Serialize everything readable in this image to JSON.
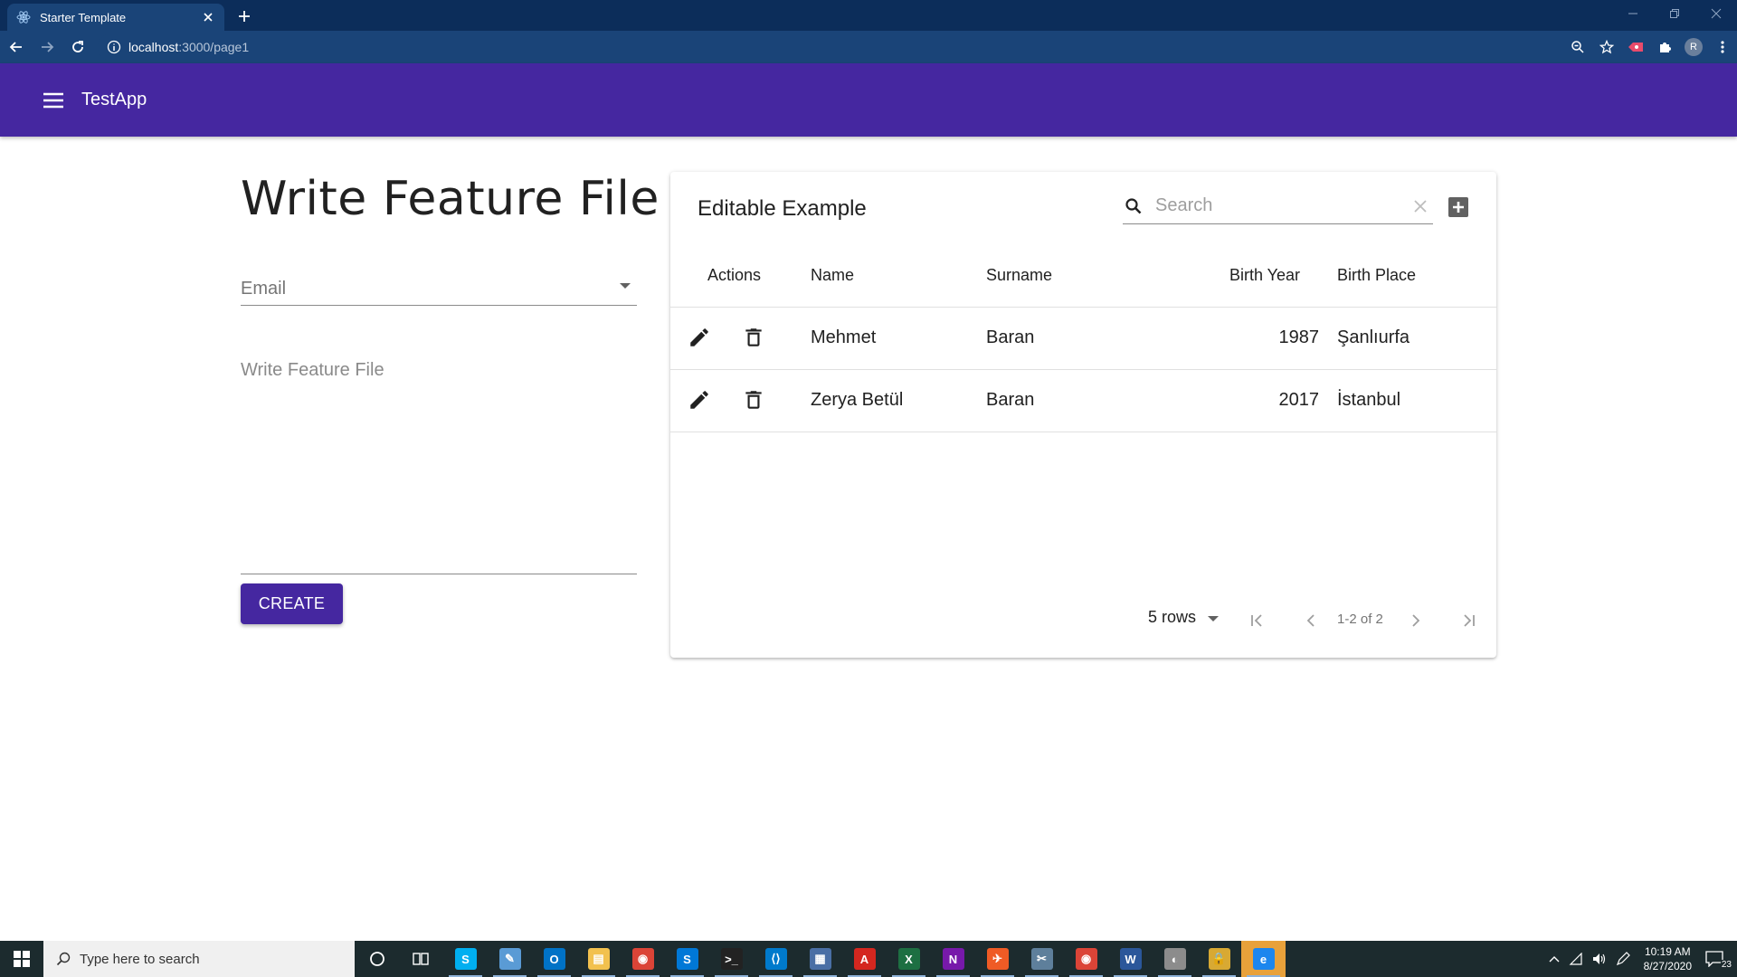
{
  "browser": {
    "tab_title": "Starter Template",
    "url_host": "localhost",
    "url_path": ":3000/page1",
    "profile_initial": "R"
  },
  "appbar": {
    "title": "TestApp",
    "color": "#4527a0"
  },
  "form": {
    "page_title": "Write Feature File",
    "email_label": "Email",
    "textarea_placeholder": "Write Feature File",
    "create_label": "CREATE"
  },
  "table": {
    "title": "Editable Example",
    "search_placeholder": "Search",
    "columns": [
      "Actions",
      "Name",
      "Surname",
      "Birth Year",
      "Birth Place"
    ],
    "rows": [
      {
        "name": "Mehmet",
        "surname": "Baran",
        "birth_year": "1987",
        "birth_place": "Şanlıurfa"
      },
      {
        "name": "Zerya Betül",
        "surname": "Baran",
        "birth_year": "2017",
        "birth_place": "İstanbul"
      }
    ],
    "rows_per_page": "5 rows",
    "page_info": "1-2 of 2"
  },
  "taskbar": {
    "search_placeholder": "Type here to search",
    "apps": [
      {
        "icon": "skype-icon",
        "color": "#00aff0",
        "label": "S"
      },
      {
        "icon": "notepad-icon",
        "color": "#5a9bd5",
        "label": "✎"
      },
      {
        "icon": "outlook-icon",
        "color": "#0072c6",
        "label": "O"
      },
      {
        "icon": "file-explorer-icon",
        "color": "#f2c14e",
        "label": "▤"
      },
      {
        "icon": "chrome-icon",
        "color": "#db4437",
        "label": "◉"
      },
      {
        "icon": "skype-business-icon",
        "color": "#0078d7",
        "label": "S"
      },
      {
        "icon": "terminal-icon",
        "color": "#222222",
        "label": ">_"
      },
      {
        "icon": "vscode-icon",
        "color": "#007acc",
        "label": "⟨⟩"
      },
      {
        "icon": "calculator-icon",
        "color": "#4a6fa5",
        "label": "▦"
      },
      {
        "icon": "acrobat-icon",
        "color": "#d4271f",
        "label": "A"
      },
      {
        "icon": "excel-icon",
        "color": "#1d6f42",
        "label": "X"
      },
      {
        "icon": "onenote-icon",
        "color": "#7719aa",
        "label": "N"
      },
      {
        "icon": "postman-icon",
        "color": "#ef5b25",
        "label": "✈"
      },
      {
        "icon": "snipping-tool-icon",
        "color": "#5e7f9b",
        "label": "✂"
      },
      {
        "icon": "chrome-profile-icon",
        "color": "#db4437",
        "label": "◉"
      },
      {
        "icon": "word-icon",
        "color": "#2b579a",
        "label": "W"
      },
      {
        "icon": "paint-icon",
        "color": "#8c8c8c",
        "label": "◐"
      },
      {
        "icon": "keepass-icon",
        "color": "#d8a933",
        "label": "🔒"
      },
      {
        "icon": "edge-icon",
        "color": "#1c86ee",
        "label": "e"
      }
    ],
    "time": "10:19 AM",
    "date": "8/27/2020",
    "notifications": "23"
  }
}
